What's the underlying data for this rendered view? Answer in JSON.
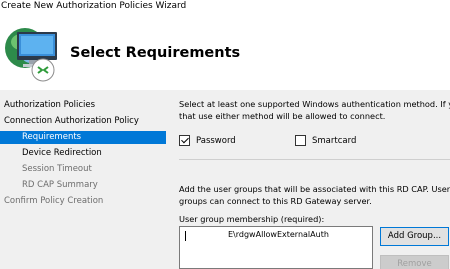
{
  "window": {
    "title": "Create New Authorization Policies Wizard"
  },
  "header": {
    "title": "Select Requirements",
    "icon": "network-computer-icon"
  },
  "sidebar": {
    "items": [
      {
        "label": "Authorization Policies",
        "state": "normal"
      },
      {
        "label": "Connection Authorization Policy",
        "state": "normal"
      },
      {
        "label": "Requirements",
        "state": "selected"
      },
      {
        "label": "Device Redirection",
        "state": "normal"
      },
      {
        "label": "Session Timeout",
        "state": "disabled"
      },
      {
        "label": "RD CAP Summary",
        "state": "disabled"
      },
      {
        "label": "Confirm Policy Creation",
        "state": "disabled"
      }
    ]
  },
  "main": {
    "auth_text_line1": "Select at least one supported Windows authentication method. If you",
    "auth_text_line2": "that use either method will be allowed to connect.",
    "password_label": "Password",
    "password_checked": true,
    "smartcard_label": "Smartcard",
    "smartcard_checked": false,
    "groups_text_line1": "Add the user groups that will be associated with this RD CAP. Users w",
    "groups_text_line2": "groups can connect to this RD Gateway server.",
    "membership_label": "User group membership (required):",
    "groups": [
      {
        "name": "E\\rdgwAllowExternalAuth"
      }
    ],
    "add_group_label": "Add Group...",
    "remove_label": "Remove"
  },
  "colors": {
    "selection": "#0078d7",
    "panel": "#f0f0f0"
  }
}
